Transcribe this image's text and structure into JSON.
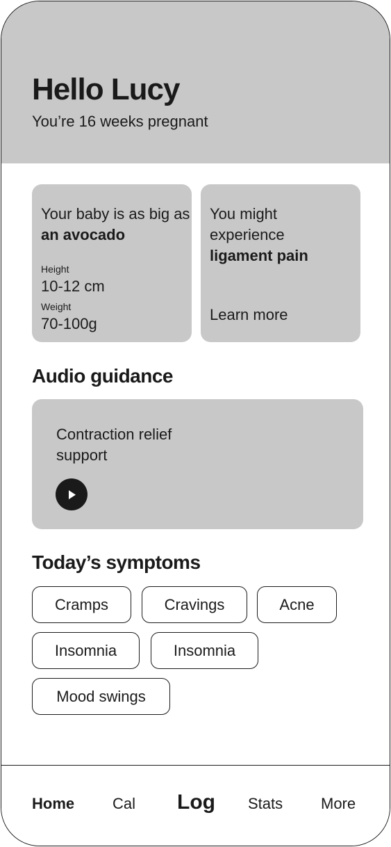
{
  "header": {
    "greeting": "Hello Lucy",
    "subtitle": "You’re 16 weeks pregnant"
  },
  "baby_card": {
    "text_prefix": "Your baby is as big as ",
    "text_bold": "an avocado",
    "height_label": "Height",
    "height_value": "10-12 cm",
    "weight_label": "Weight",
    "weight_value": "70-100g"
  },
  "symptom_card": {
    "text_prefix": "You might experience ",
    "text_bold": "ligament pain",
    "link_label": "Learn more"
  },
  "audio": {
    "section_title": "Audio guidance",
    "track_title": "Contraction relief support",
    "play_icon": "play-icon"
  },
  "symptoms": {
    "section_title": "Today’s symptoms",
    "chips": [
      "Cramps",
      "Cravings",
      "Acne",
      "Insomnia",
      "Insomnia",
      "Mood swings"
    ]
  },
  "nav": {
    "tabs": [
      "Home",
      "Cal",
      "Log",
      "Stats",
      "More"
    ],
    "active": "Home"
  },
  "colors": {
    "card_background": "#c8c8c8",
    "text": "#1a1a1a",
    "background": "#ffffff"
  }
}
